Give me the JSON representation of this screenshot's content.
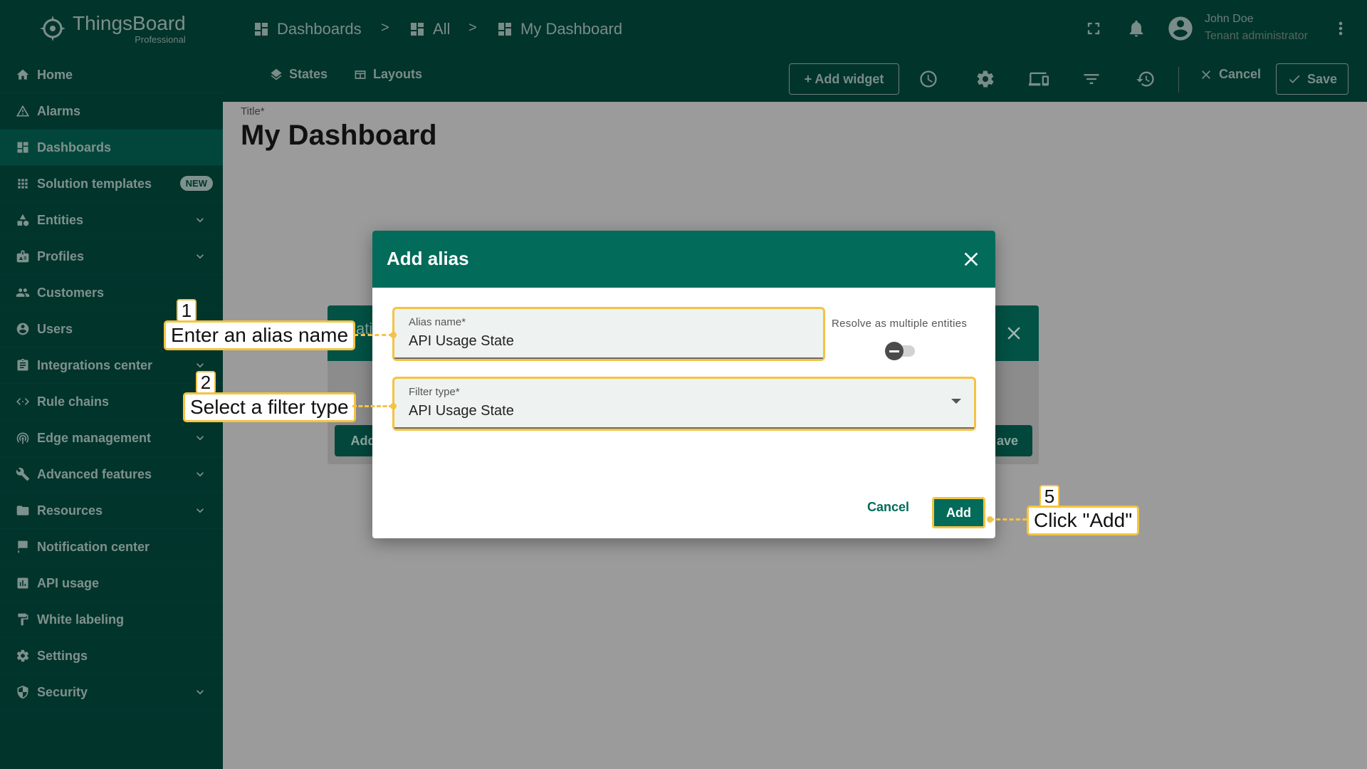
{
  "app": {
    "name": "ThingsBoard",
    "edition": "Professional"
  },
  "sidebar": {
    "items": [
      {
        "label": "Home",
        "icon": "home-icon",
        "chevron": false
      },
      {
        "label": "Alarms",
        "icon": "alarm-icon",
        "chevron": false
      },
      {
        "label": "Dashboards",
        "icon": "dashboard-icon",
        "chevron": false,
        "active": true
      },
      {
        "label": "Solution templates",
        "icon": "apps-icon",
        "chevron": false,
        "badge": "NEW"
      },
      {
        "label": "Entities",
        "icon": "entities-icon",
        "chevron": true
      },
      {
        "label": "Profiles",
        "icon": "profiles-icon",
        "chevron": true
      },
      {
        "label": "Customers",
        "icon": "customers-icon",
        "chevron": false
      },
      {
        "label": "Users",
        "icon": "user-icon",
        "chevron": false
      },
      {
        "label": "Integrations center",
        "icon": "integrations-icon",
        "chevron": true
      },
      {
        "label": "Rule chains",
        "icon": "code-icon",
        "chevron": false
      },
      {
        "label": "Edge management",
        "icon": "edge-icon",
        "chevron": true
      },
      {
        "label": "Advanced features",
        "icon": "tools-icon",
        "chevron": true
      },
      {
        "label": "Resources",
        "icon": "folder-icon",
        "chevron": true
      },
      {
        "label": "Notification center",
        "icon": "notification-icon",
        "chevron": false
      },
      {
        "label": "API usage",
        "icon": "chart-icon",
        "chevron": false
      },
      {
        "label": "White labeling",
        "icon": "paint-roller-icon",
        "chevron": false
      },
      {
        "label": "Settings",
        "icon": "gear-icon",
        "chevron": false
      },
      {
        "label": "Security",
        "icon": "shield-icon",
        "chevron": true
      }
    ]
  },
  "header": {
    "breadcrumbs": [
      "Dashboards",
      "All",
      "My Dashboard"
    ],
    "separator": ">",
    "user": {
      "name": "John Doe",
      "role": "Tenant administrator"
    }
  },
  "toolbar": {
    "states": "States",
    "layouts": "Layouts",
    "add_widget": "+ Add widget",
    "cancel": "Cancel",
    "save": "Save"
  },
  "dashboard": {
    "title_label": "Title*",
    "title": "My Dashboard"
  },
  "back_dialog": {
    "header_fragment": "ati",
    "add_fragment": "Add",
    "save_fragment": "ave"
  },
  "dialog": {
    "title": "Add alias",
    "alias_name_label": "Alias name*",
    "alias_name_value": "API Usage State",
    "resolve_label": "Resolve as multiple entities",
    "resolve_multiple": false,
    "filter_type_label": "Filter type*",
    "filter_type_value": "API Usage State",
    "cancel": "Cancel",
    "add": "Add"
  },
  "callouts": [
    {
      "number": "1",
      "text": "Enter an alias name"
    },
    {
      "number": "2",
      "text": "Select a filter type"
    },
    {
      "number": "5",
      "text": "Click \"Add\""
    }
  ],
  "colors": {
    "sidebar_bg": "#01342b",
    "primary": "#026b5a",
    "highlight": "#f5c342"
  }
}
